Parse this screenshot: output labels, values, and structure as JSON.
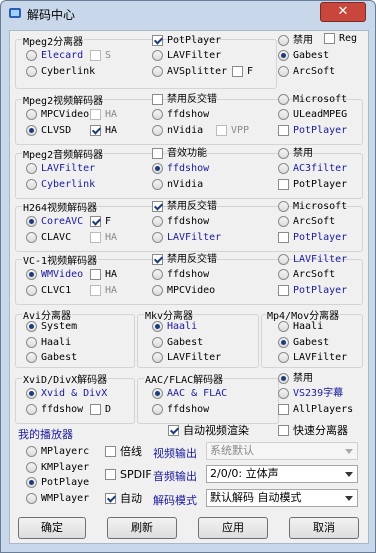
{
  "window": {
    "title": "解码中心",
    "close_symbol": "✕"
  },
  "top_reg": {
    "label": "Reg",
    "checked": false
  },
  "sections": {
    "mpeg2_splitter": {
      "title": "Mpeg2分离器",
      "col1": [
        {
          "label": "Elecard",
          "type": "radio",
          "on": false,
          "style": "blue"
        },
        {
          "label": "S",
          "type": "check",
          "on": false,
          "style": "gray"
        },
        {
          "label": "Cyberlink",
          "type": "radio",
          "on": false
        }
      ],
      "col2": [
        {
          "label": "PotPlayer",
          "type": "check",
          "on": true
        },
        {
          "label": "LAVFilter",
          "type": "radio",
          "on": false
        },
        {
          "label": "AVSplitter",
          "type": "radio",
          "on": false
        },
        {
          "label": "F",
          "type": "check",
          "on": false
        }
      ],
      "col3": [
        {
          "label": "禁用",
          "type": "radio",
          "on": false
        },
        {
          "label": "Gabest",
          "type": "radio",
          "on": true
        },
        {
          "label": "ArcSoft",
          "type": "radio",
          "on": false
        }
      ]
    },
    "mpeg2_video": {
      "title": "Mpeg2视频解码器",
      "col1": [
        {
          "label": "MPCVideo",
          "type": "radio",
          "on": false
        },
        {
          "label": "HA",
          "type": "check",
          "on": false,
          "style": "gray"
        },
        {
          "label": "CLVSD",
          "type": "radio",
          "on": true
        },
        {
          "label": "HA",
          "type": "check",
          "on": true
        }
      ],
      "col2": [
        {
          "label": "禁用反交错",
          "type": "check",
          "on": false
        },
        {
          "label": "ffdshow",
          "type": "radio",
          "on": false
        },
        {
          "label": "nVidia",
          "type": "radio",
          "on": false
        },
        {
          "label": "VPP",
          "type": "check",
          "on": false,
          "style": "gray"
        }
      ],
      "col3": [
        {
          "label": "Microsoft",
          "type": "radio",
          "on": false
        },
        {
          "label": "ULeadMPEG",
          "type": "radio",
          "on": false
        },
        {
          "label": "PotPlayer",
          "type": "check",
          "on": false,
          "style": "blue"
        }
      ]
    },
    "mpeg2_audio": {
      "title": "Mpeg2音频解码器",
      "col1": [
        {
          "label": "LAVFilter",
          "type": "radio",
          "on": false,
          "style": "blue"
        },
        {
          "label": "Cyberlink",
          "type": "radio",
          "on": false,
          "style": "blue"
        }
      ],
      "col2": [
        {
          "label": "音效功能",
          "type": "check",
          "on": false
        },
        {
          "label": "ffdshow",
          "type": "radio",
          "on": true,
          "style": "blue"
        },
        {
          "label": "nVidia",
          "type": "radio",
          "on": false
        }
      ],
      "col3": [
        {
          "label": "禁用",
          "type": "radio",
          "on": false
        },
        {
          "label": "AC3filter",
          "type": "radio",
          "on": false,
          "style": "blue"
        },
        {
          "label": "PotPlayer",
          "type": "check",
          "on": false
        }
      ]
    },
    "h264": {
      "title": "H264视频解码器",
      "col1": [
        {
          "label": "CoreAVC",
          "type": "radio",
          "on": true,
          "style": "blue"
        },
        {
          "label": "F",
          "type": "check",
          "on": true
        },
        {
          "label": "CLAVC",
          "type": "radio",
          "on": false
        },
        {
          "label": "HA",
          "type": "check",
          "on": false,
          "style": "gray"
        }
      ],
      "col2": [
        {
          "label": "禁用反交错",
          "type": "check",
          "on": true
        },
        {
          "label": "ffdshow",
          "type": "radio",
          "on": false
        },
        {
          "label": "LAVFilter",
          "type": "radio",
          "on": false,
          "style": "blue"
        }
      ],
      "col3": [
        {
          "label": "Microsoft",
          "type": "radio",
          "on": false
        },
        {
          "label": "ArcSoft",
          "type": "radio",
          "on": false
        },
        {
          "label": "PotPlayer",
          "type": "check",
          "on": false,
          "style": "blue"
        }
      ]
    },
    "vc1": {
      "title": "VC-1视频解码器",
      "col1": [
        {
          "label": "WMVideo",
          "type": "radio",
          "on": true,
          "style": "blue"
        },
        {
          "label": "HA",
          "type": "check",
          "on": false
        },
        {
          "label": "CLVC1",
          "type": "radio",
          "on": false
        },
        {
          "label": "HA",
          "type": "check",
          "on": false,
          "style": "gray"
        }
      ],
      "col2": [
        {
          "label": "禁用反交错",
          "type": "check",
          "on": true
        },
        {
          "label": "ffdshow",
          "type": "radio",
          "on": false
        },
        {
          "label": "MPCVideo",
          "type": "radio",
          "on": false
        }
      ],
      "col3": [
        {
          "label": "LAVFilter",
          "type": "radio",
          "on": false,
          "style": "blue"
        },
        {
          "label": "ArcSoft",
          "type": "radio",
          "on": false
        },
        {
          "label": "PotPlayer",
          "type": "check",
          "on": false,
          "style": "blue"
        }
      ]
    },
    "avi": {
      "title": "Avi分离器",
      "items": [
        {
          "label": "System",
          "on": true
        },
        {
          "label": "Haali",
          "on": false
        },
        {
          "label": "Gabest",
          "on": false
        }
      ]
    },
    "mkv": {
      "title": "Mkv分离器",
      "items": [
        {
          "label": "Haali",
          "on": true,
          "style": "blue"
        },
        {
          "label": "Gabest",
          "on": false
        },
        {
          "label": "LAVFilter",
          "on": false
        }
      ]
    },
    "mp4": {
      "title": "Mp4/Mov分离器",
      "items": [
        {
          "label": "Haali",
          "on": false
        },
        {
          "label": "Gabest",
          "on": true
        },
        {
          "label": "LAVFilter",
          "on": false
        }
      ]
    },
    "xvid": {
      "title": "XviD/DivX解码器",
      "items": [
        {
          "label": "Xvid & DivX",
          "type": "radio",
          "on": true,
          "style": "blue"
        },
        {
          "label": "ffdshow",
          "type": "radio",
          "on": false
        },
        {
          "label": "D",
          "type": "check",
          "on": false
        }
      ]
    },
    "aac": {
      "title": "AAC/FLAC解码器",
      "items": [
        {
          "label": "AAC & FLAC",
          "type": "radio",
          "on": true,
          "style": "blue"
        },
        {
          "label": "ffdshow",
          "type": "radio",
          "on": false
        }
      ]
    },
    "right_misc": {
      "items": [
        {
          "label": "禁用",
          "type": "radio",
          "on": true
        },
        {
          "label": "VS239字幕",
          "type": "radio",
          "on": false,
          "style": "blue"
        },
        {
          "label": "AllPlayers",
          "type": "check",
          "on": false
        }
      ]
    }
  },
  "player": {
    "title": "我的播放器",
    "items": [
      {
        "label": "MPlayerc",
        "on": false
      },
      {
        "label": "KMPlayer",
        "on": false
      },
      {
        "label": "PotPlaye",
        "on": true
      },
      {
        "label": "WMPlayer",
        "on": false
      }
    ]
  },
  "bottom": {
    "auto_render": {
      "label": "自动视频渲染",
      "checked": true
    },
    "fast_split": {
      "label": "快速分离器",
      "checked": false
    },
    "double": {
      "label": "倍线",
      "checked": false
    },
    "video_out_label": "视频输出",
    "video_out_value": "系统默认",
    "spdif": {
      "label": "SPDIF",
      "checked": false
    },
    "audio_out_label": "音频输出",
    "audio_out_value": "2/0/0: 立体声",
    "auto": {
      "label": "自动",
      "checked": true
    },
    "decode_mode_label": "解码模式",
    "decode_mode_value": "默认解码 自动模式"
  },
  "buttons": {
    "ok": "确定",
    "refresh": "刷新",
    "apply": "应用",
    "cancel": "取消"
  }
}
